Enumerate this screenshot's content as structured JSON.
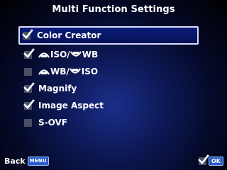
{
  "title": "Multi Function Settings",
  "items": [
    {
      "label": "Color Creator",
      "checked": true,
      "selected": true
    },
    {
      "label_a": "ISO/",
      "label_b": "WB",
      "checked": true,
      "icon": "front-dial-icon"
    },
    {
      "label_a": "WB/",
      "label_b": "ISO",
      "checked": false,
      "icon": "front-dial-icon"
    },
    {
      "label": "Magnify",
      "checked": true
    },
    {
      "label": "Image Aspect",
      "checked": true
    },
    {
      "label": "S-OVF",
      "checked": false
    }
  ],
  "footer": {
    "back_label": "Back",
    "menu_button": "MENU",
    "ok_button": "OK"
  },
  "colors": {
    "selection_border": "#d8dcff",
    "button_blue": "#2a5dc9",
    "checkbox_bg": "#4a4f66"
  }
}
